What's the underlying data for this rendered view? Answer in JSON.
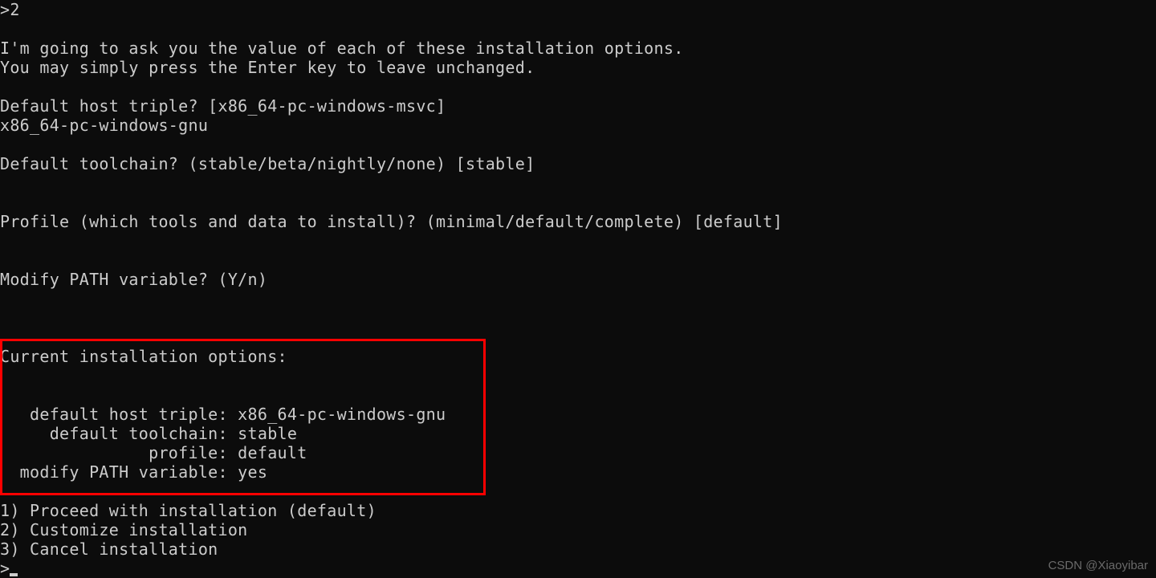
{
  "terminal": {
    "prompt_input": ">2",
    "intro_line1": "I'm going to ask you the value of each of these installation options.",
    "intro_line2": "You may simply press the Enter key to leave unchanged.",
    "host_triple_prompt": "Default host triple? [x86_64-pc-windows-msvc]",
    "host_triple_answer": "x86_64-pc-windows-gnu",
    "toolchain_prompt": "Default toolchain? (stable/beta/nightly/none) [stable]",
    "profile_prompt": "Profile (which tools and data to install)? (minimal/default/complete) [default]",
    "path_prompt": "Modify PATH variable? (Y/n)",
    "options_header": "Current installation options:",
    "option_host": "   default host triple: x86_64-pc-windows-gnu",
    "option_toolchain": "     default toolchain: stable",
    "option_profile": "               profile: default",
    "option_path": "  modify PATH variable: yes",
    "menu_1": "1) Proceed with installation (default)",
    "menu_2": "2) Customize installation",
    "menu_3": "3) Cancel installation",
    "final_prompt": ">"
  },
  "watermark": "CSDN @Xiaoyibar"
}
